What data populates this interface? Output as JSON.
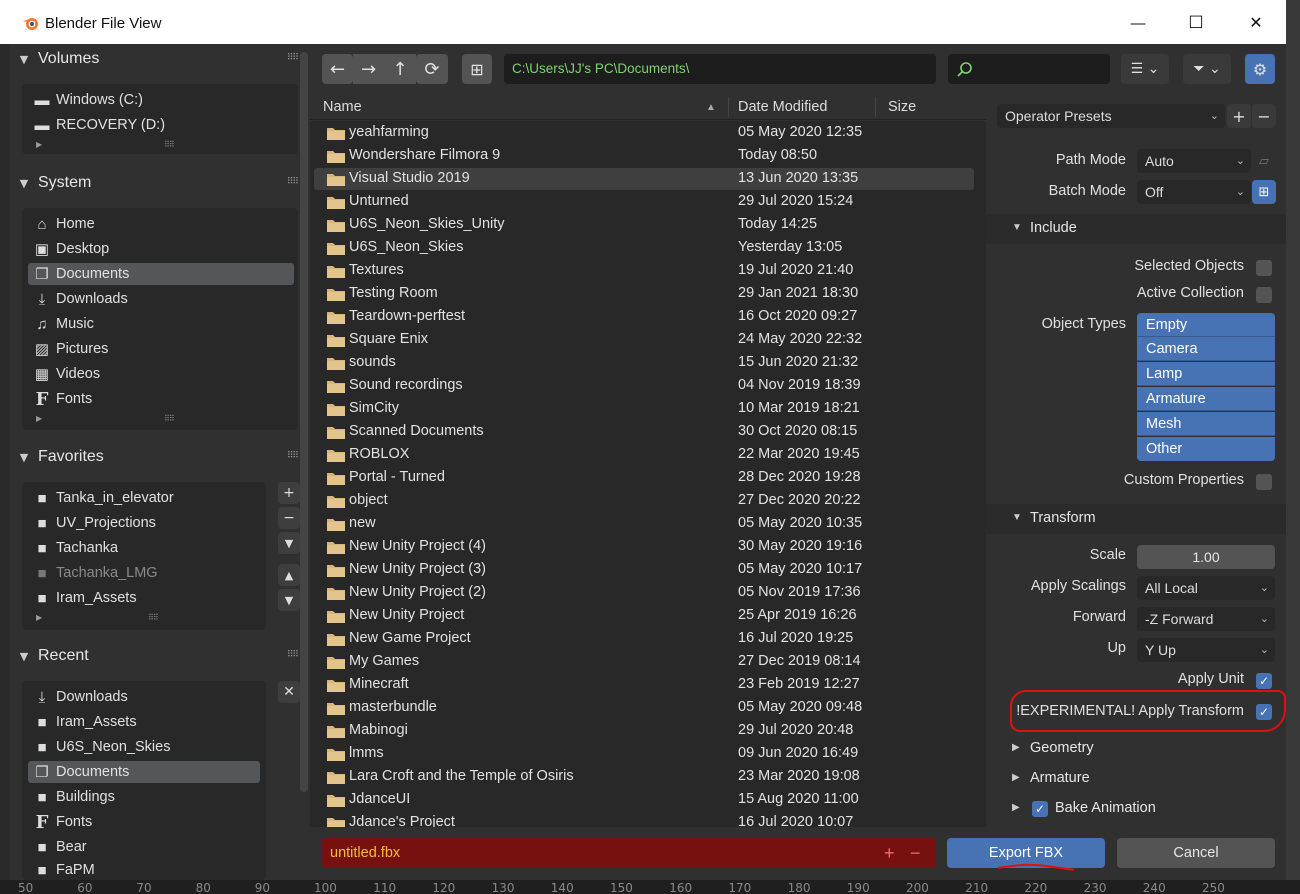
{
  "window": {
    "title": "Blender File View",
    "minimize": "—",
    "maximize": "☐",
    "close": "✕"
  },
  "sidebar": {
    "volumes": {
      "title": "Volumes",
      "items": [
        {
          "label": "Windows (C:)"
        },
        {
          "label": "RECOVERY (D:)"
        }
      ]
    },
    "system": {
      "title": "System",
      "items": [
        {
          "label": "Home"
        },
        {
          "label": "Desktop"
        },
        {
          "label": "Documents"
        },
        {
          "label": "Downloads"
        },
        {
          "label": "Music"
        },
        {
          "label": "Pictures"
        },
        {
          "label": "Videos"
        },
        {
          "label": "Fonts"
        }
      ]
    },
    "favorites": {
      "title": "Favorites",
      "items": [
        {
          "label": "Tanka_in_elevator"
        },
        {
          "label": "UV_Projections"
        },
        {
          "label": "Tachanka"
        },
        {
          "label": "Tachanka_LMG"
        },
        {
          "label": "Iram_Assets"
        }
      ]
    },
    "recent": {
      "title": "Recent",
      "items": [
        {
          "label": "Downloads"
        },
        {
          "label": "Iram_Assets"
        },
        {
          "label": "U6S_Neon_Skies"
        },
        {
          "label": "Documents"
        },
        {
          "label": "Buildings"
        },
        {
          "label": "Fonts"
        },
        {
          "label": "Bear"
        },
        {
          "label": "FaPM"
        }
      ]
    }
  },
  "toolbar": {
    "path": "C:\\Users\\JJ's PC\\Documents\\",
    "search_value": ""
  },
  "list": {
    "col_name": "Name",
    "col_date": "Date Modified",
    "col_size": "Size",
    "rows": [
      {
        "name": "yeahfarming",
        "date": "05 May 2020 12:35"
      },
      {
        "name": "Wondershare Filmora 9",
        "date": "Today 08:50"
      },
      {
        "name": "Visual Studio 2019",
        "date": "13 Jun 2020 13:35"
      },
      {
        "name": "Unturned",
        "date": "29 Jul 2020 15:24"
      },
      {
        "name": "U6S_Neon_Skies_Unity",
        "date": "Today 14:25"
      },
      {
        "name": "U6S_Neon_Skies",
        "date": "Yesterday 13:05"
      },
      {
        "name": "Textures",
        "date": "19 Jul 2020 21:40"
      },
      {
        "name": "Testing Room",
        "date": "29 Jan 2021 18:30"
      },
      {
        "name": "Teardown-perftest",
        "date": "16 Oct 2020 09:27"
      },
      {
        "name": "Square Enix",
        "date": "24 May 2020 22:32"
      },
      {
        "name": "sounds",
        "date": "15 Jun 2020 21:32"
      },
      {
        "name": "Sound recordings",
        "date": "04 Nov 2019 18:39"
      },
      {
        "name": "SimCity",
        "date": "10 Mar 2019 18:21"
      },
      {
        "name": "Scanned Documents",
        "date": "30 Oct 2020 08:15"
      },
      {
        "name": "ROBLOX",
        "date": "22 Mar 2020 19:45"
      },
      {
        "name": "Portal - Turned",
        "date": "28 Dec 2020 19:28"
      },
      {
        "name": "object",
        "date": "27 Dec 2020 20:22"
      },
      {
        "name": "new",
        "date": "05 May 2020 10:35"
      },
      {
        "name": "New Unity Project (4)",
        "date": "30 May 2020 19:16"
      },
      {
        "name": "New Unity Project (3)",
        "date": "05 May 2020 10:17"
      },
      {
        "name": "New Unity Project (2)",
        "date": "05 Nov 2019 17:36"
      },
      {
        "name": "New Unity Project",
        "date": "25 Apr 2019 16:26"
      },
      {
        "name": "New Game Project",
        "date": "16 Jul 2020 19:25"
      },
      {
        "name": "My Games",
        "date": "27 Dec 2019 08:14"
      },
      {
        "name": "Minecraft",
        "date": "23 Feb 2019 12:27"
      },
      {
        "name": "masterbundle",
        "date": "05 May 2020 09:48"
      },
      {
        "name": "Mabinogi",
        "date": "29 Jul 2020 20:48"
      },
      {
        "name": "lmms",
        "date": "09 Jun 2020 16:49"
      },
      {
        "name": "Lara Croft and the Temple of Osiris",
        "date": "23 Mar 2020 19:08"
      },
      {
        "name": "JdanceUI",
        "date": "15 Aug 2020 11:00"
      },
      {
        "name": "Jdance's Project",
        "date": "16 Jul 2020 10:07"
      }
    ]
  },
  "bottom": {
    "filename": "untitled.fbx",
    "plus": "+",
    "minus": "−",
    "export_label": "Export FBX",
    "cancel_label": "Cancel"
  },
  "options": {
    "presets_label": "Operator Presets",
    "path_mode_label": "Path Mode",
    "path_mode_value": "Auto",
    "batch_mode_label": "Batch Mode",
    "batch_mode_value": "Off",
    "include_title": "Include",
    "selected_objects": "Selected Objects",
    "active_collection": "Active Collection",
    "object_types_label": "Object Types",
    "object_types": [
      "Empty",
      "Camera",
      "Lamp",
      "Armature",
      "Mesh",
      "Other"
    ],
    "custom_properties": "Custom Properties",
    "transform_title": "Transform",
    "scale_label": "Scale",
    "scale_value": "1.00",
    "apply_scalings_label": "Apply Scalings",
    "apply_scalings_value": "All Local",
    "forward_label": "Forward",
    "forward_value": "-Z Forward",
    "up_label": "Up",
    "up_value": "Y Up",
    "apply_unit": "Apply Unit",
    "apply_transform": "!EXPERIMENTAL! Apply Transform",
    "geometry_title": "Geometry",
    "armature_title": "Armature",
    "bake_animation_title": "Bake Animation"
  },
  "ruler": [
    "50",
    "60",
    "70",
    "80",
    "90",
    "100",
    "110",
    "120",
    "130",
    "140",
    "150",
    "160",
    "170",
    "180",
    "190",
    "200",
    "210",
    "220",
    "230",
    "240",
    "250"
  ],
  "colors": {
    "accent": "#4772b3",
    "path_text": "#7fd36f",
    "filename_bg": "#771110",
    "filename_text": "#f2bd3f",
    "annotation": "#e01010"
  }
}
